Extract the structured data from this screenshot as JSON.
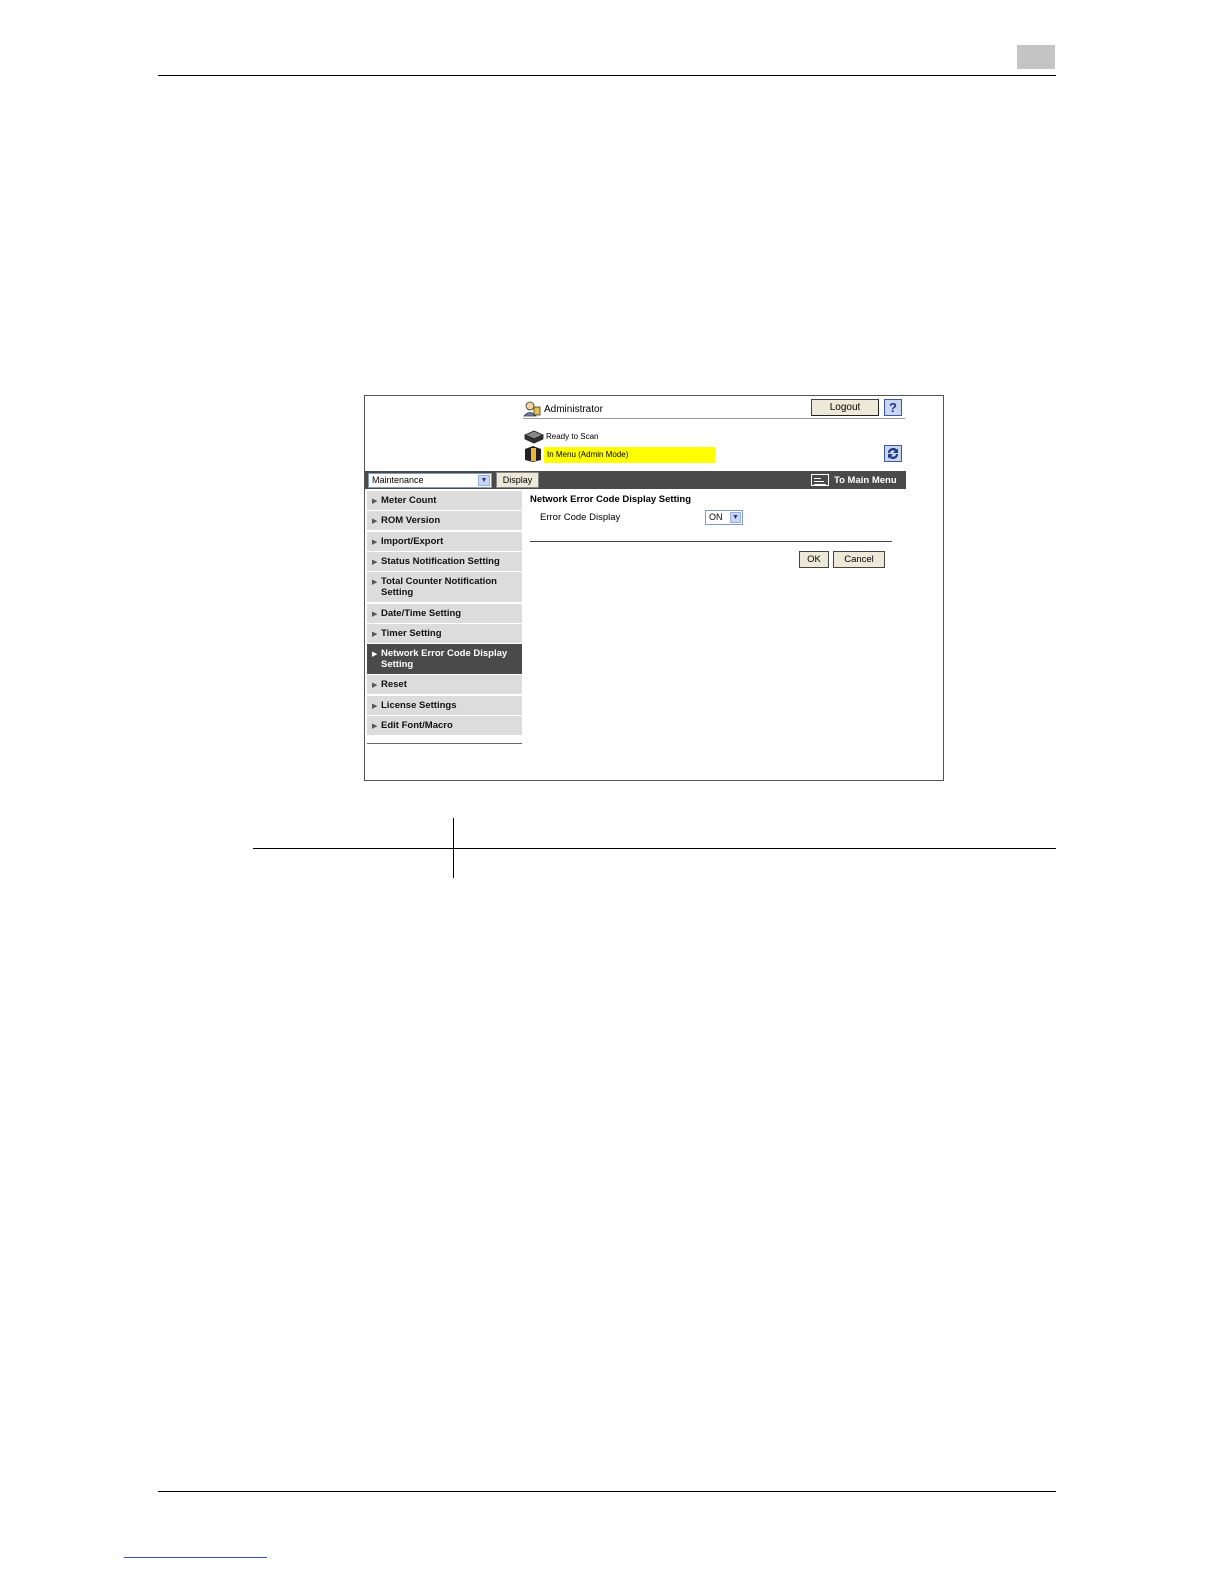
{
  "header": {
    "user_label": "Administrator",
    "logout_label": "Logout",
    "help_label": "?"
  },
  "status": {
    "scan_status": "Ready to Scan",
    "mode_status": "In Menu (Admin Mode)"
  },
  "toolbar": {
    "mode_select_value": "Maintenance",
    "display_label": "Display",
    "main_menu_label": "To Main Menu"
  },
  "sidebar": {
    "items": [
      {
        "label_lines": [
          "Meter Count"
        ],
        "active": false
      },
      {
        "label_lines": [
          "ROM Version"
        ],
        "active": false
      },
      {
        "label_lines": [
          "Import/Export"
        ],
        "active": false
      },
      {
        "label_lines": [
          "Status Notification Setting"
        ],
        "active": false
      },
      {
        "label_lines": [
          "Total Counter Notification",
          "Setting"
        ],
        "active": false
      },
      {
        "label_lines": [
          "Date/Time Setting"
        ],
        "active": false
      },
      {
        "label_lines": [
          "Timer Setting"
        ],
        "active": false
      },
      {
        "label_lines": [
          "Network Error Code Display",
          "Setting"
        ],
        "active": true
      },
      {
        "label_lines": [
          "Reset"
        ],
        "active": false
      },
      {
        "label_lines": [
          "License Settings"
        ],
        "active": false
      },
      {
        "label_lines": [
          "Edit Font/Macro"
        ],
        "active": false
      }
    ]
  },
  "content": {
    "title": "Network Error Code Display Setting",
    "field_label": "Error Code Display",
    "field_value": "ON",
    "ok_label": "OK",
    "cancel_label": "Cancel"
  },
  "icons": {
    "admin": "administrator-icon",
    "scan": "scanner-icon",
    "status": "machine-status-icon",
    "refresh": "refresh-icon",
    "main_menu": "main-menu-icon",
    "dropdown": "chevron-down-icon",
    "sidebar_arrow": "triangle-right-icon"
  }
}
